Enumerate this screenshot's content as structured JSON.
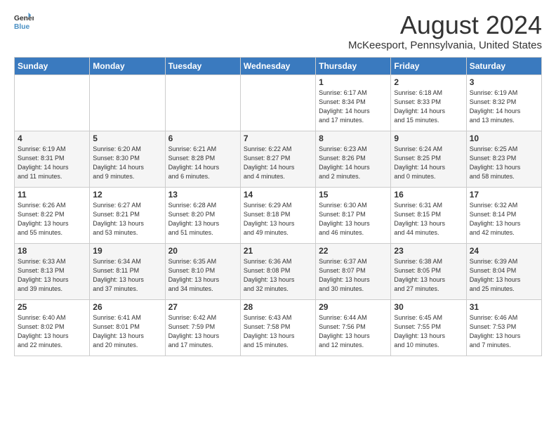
{
  "logo": {
    "line1": "General",
    "line2": "Blue"
  },
  "title": "August 2024",
  "subtitle": "McKeesport, Pennsylvania, United States",
  "days_of_week": [
    "Sunday",
    "Monday",
    "Tuesday",
    "Wednesday",
    "Thursday",
    "Friday",
    "Saturday"
  ],
  "weeks": [
    [
      {
        "day": "",
        "info": ""
      },
      {
        "day": "",
        "info": ""
      },
      {
        "day": "",
        "info": ""
      },
      {
        "day": "",
        "info": ""
      },
      {
        "day": "1",
        "info": "Sunrise: 6:17 AM\nSunset: 8:34 PM\nDaylight: 14 hours\nand 17 minutes."
      },
      {
        "day": "2",
        "info": "Sunrise: 6:18 AM\nSunset: 8:33 PM\nDaylight: 14 hours\nand 15 minutes."
      },
      {
        "day": "3",
        "info": "Sunrise: 6:19 AM\nSunset: 8:32 PM\nDaylight: 14 hours\nand 13 minutes."
      }
    ],
    [
      {
        "day": "4",
        "info": "Sunrise: 6:19 AM\nSunset: 8:31 PM\nDaylight: 14 hours\nand 11 minutes."
      },
      {
        "day": "5",
        "info": "Sunrise: 6:20 AM\nSunset: 8:30 PM\nDaylight: 14 hours\nand 9 minutes."
      },
      {
        "day": "6",
        "info": "Sunrise: 6:21 AM\nSunset: 8:28 PM\nDaylight: 14 hours\nand 6 minutes."
      },
      {
        "day": "7",
        "info": "Sunrise: 6:22 AM\nSunset: 8:27 PM\nDaylight: 14 hours\nand 4 minutes."
      },
      {
        "day": "8",
        "info": "Sunrise: 6:23 AM\nSunset: 8:26 PM\nDaylight: 14 hours\nand 2 minutes."
      },
      {
        "day": "9",
        "info": "Sunrise: 6:24 AM\nSunset: 8:25 PM\nDaylight: 14 hours\nand 0 minutes."
      },
      {
        "day": "10",
        "info": "Sunrise: 6:25 AM\nSunset: 8:23 PM\nDaylight: 13 hours\nand 58 minutes."
      }
    ],
    [
      {
        "day": "11",
        "info": "Sunrise: 6:26 AM\nSunset: 8:22 PM\nDaylight: 13 hours\nand 55 minutes."
      },
      {
        "day": "12",
        "info": "Sunrise: 6:27 AM\nSunset: 8:21 PM\nDaylight: 13 hours\nand 53 minutes."
      },
      {
        "day": "13",
        "info": "Sunrise: 6:28 AM\nSunset: 8:20 PM\nDaylight: 13 hours\nand 51 minutes."
      },
      {
        "day": "14",
        "info": "Sunrise: 6:29 AM\nSunset: 8:18 PM\nDaylight: 13 hours\nand 49 minutes."
      },
      {
        "day": "15",
        "info": "Sunrise: 6:30 AM\nSunset: 8:17 PM\nDaylight: 13 hours\nand 46 minutes."
      },
      {
        "day": "16",
        "info": "Sunrise: 6:31 AM\nSunset: 8:15 PM\nDaylight: 13 hours\nand 44 minutes."
      },
      {
        "day": "17",
        "info": "Sunrise: 6:32 AM\nSunset: 8:14 PM\nDaylight: 13 hours\nand 42 minutes."
      }
    ],
    [
      {
        "day": "18",
        "info": "Sunrise: 6:33 AM\nSunset: 8:13 PM\nDaylight: 13 hours\nand 39 minutes."
      },
      {
        "day": "19",
        "info": "Sunrise: 6:34 AM\nSunset: 8:11 PM\nDaylight: 13 hours\nand 37 minutes."
      },
      {
        "day": "20",
        "info": "Sunrise: 6:35 AM\nSunset: 8:10 PM\nDaylight: 13 hours\nand 34 minutes."
      },
      {
        "day": "21",
        "info": "Sunrise: 6:36 AM\nSunset: 8:08 PM\nDaylight: 13 hours\nand 32 minutes."
      },
      {
        "day": "22",
        "info": "Sunrise: 6:37 AM\nSunset: 8:07 PM\nDaylight: 13 hours\nand 30 minutes."
      },
      {
        "day": "23",
        "info": "Sunrise: 6:38 AM\nSunset: 8:05 PM\nDaylight: 13 hours\nand 27 minutes."
      },
      {
        "day": "24",
        "info": "Sunrise: 6:39 AM\nSunset: 8:04 PM\nDaylight: 13 hours\nand 25 minutes."
      }
    ],
    [
      {
        "day": "25",
        "info": "Sunrise: 6:40 AM\nSunset: 8:02 PM\nDaylight: 13 hours\nand 22 minutes."
      },
      {
        "day": "26",
        "info": "Sunrise: 6:41 AM\nSunset: 8:01 PM\nDaylight: 13 hours\nand 20 minutes."
      },
      {
        "day": "27",
        "info": "Sunrise: 6:42 AM\nSunset: 7:59 PM\nDaylight: 13 hours\nand 17 minutes."
      },
      {
        "day": "28",
        "info": "Sunrise: 6:43 AM\nSunset: 7:58 PM\nDaylight: 13 hours\nand 15 minutes."
      },
      {
        "day": "29",
        "info": "Sunrise: 6:44 AM\nSunset: 7:56 PM\nDaylight: 13 hours\nand 12 minutes."
      },
      {
        "day": "30",
        "info": "Sunrise: 6:45 AM\nSunset: 7:55 PM\nDaylight: 13 hours\nand 10 minutes."
      },
      {
        "day": "31",
        "info": "Sunrise: 6:46 AM\nSunset: 7:53 PM\nDaylight: 13 hours\nand 7 minutes."
      }
    ]
  ]
}
